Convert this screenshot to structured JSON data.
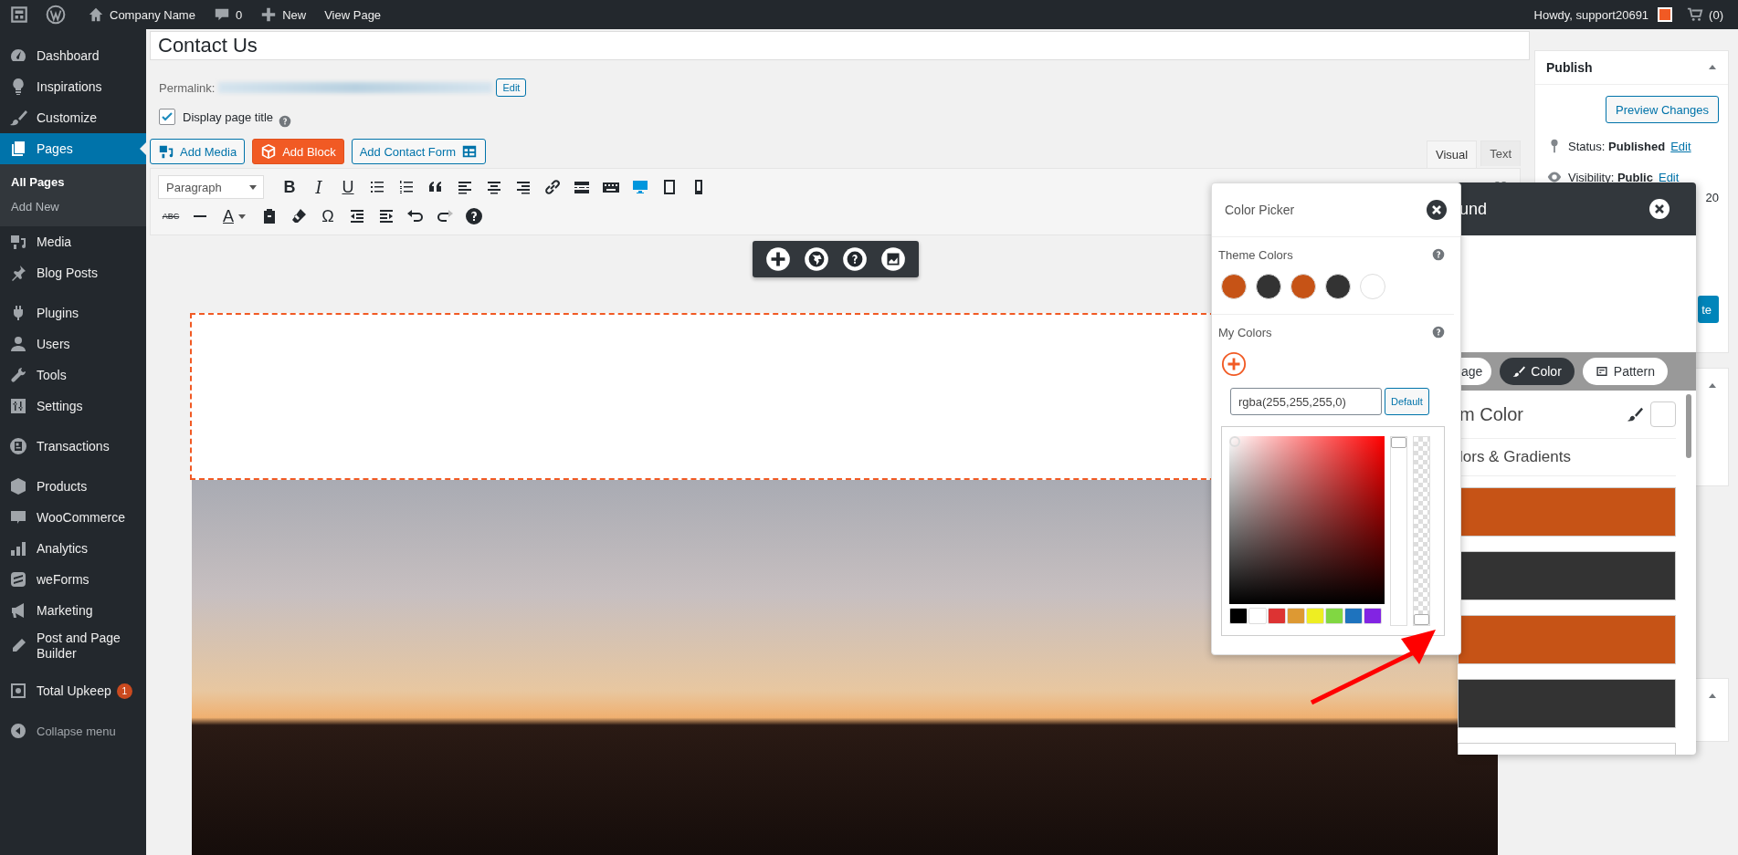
{
  "admin_bar": {
    "items": [
      {
        "kind": "home",
        "label": "Company Name"
      },
      {
        "kind": "comment",
        "label": "0"
      },
      {
        "kind": "plus",
        "label": "New"
      },
      {
        "kind": "none",
        "label": "View Page"
      }
    ],
    "greeting": "Howdy, support20691",
    "cart": "(0)"
  },
  "sidebar": {
    "groups": [
      [
        {
          "kind": "gauge",
          "label": "Dashboard",
          "selected": false
        },
        {
          "kind": "bulb",
          "label": "Inspirations",
          "selected": false
        },
        {
          "kind": "brush",
          "label": "Customize",
          "selected": false
        },
        {
          "kind": "pages",
          "label": "Pages",
          "selected": true,
          "submenu": [
            {
              "label": "All Pages",
              "selected": true
            },
            {
              "label": "Add New",
              "selected": false
            }
          ]
        },
        {
          "kind": "media",
          "label": "Media",
          "selected": false
        },
        {
          "kind": "pin",
          "label": "Blog Posts",
          "selected": false
        }
      ],
      [
        {
          "kind": "plug",
          "label": "Plugins",
          "selected": false
        },
        {
          "kind": "user",
          "label": "Users",
          "selected": false
        },
        {
          "kind": "wrench",
          "label": "Tools",
          "selected": false
        },
        {
          "kind": "sliders",
          "label": "Settings",
          "selected": false
        }
      ],
      [
        {
          "kind": "doc",
          "label": "Transactions",
          "selected": false
        }
      ],
      [
        {
          "kind": "box",
          "label": "Products",
          "selected": false
        },
        {
          "kind": "woo",
          "label": "WooCommerce",
          "selected": false
        },
        {
          "kind": "bars",
          "label": "Analytics",
          "selected": false
        },
        {
          "kind": "forms",
          "label": "weForms",
          "selected": false
        },
        {
          "kind": "megaphone",
          "label": "Marketing",
          "selected": false
        },
        {
          "kind": "pencil",
          "label": "Post and Page Builder",
          "selected": false
        }
      ],
      [
        {
          "kind": "safe",
          "label": "Total Upkeep",
          "selected": false,
          "badge": "1"
        }
      ]
    ],
    "collapse": "Collapse menu"
  },
  "editor": {
    "title": "Contact Us",
    "permalink_label": "Permalink:",
    "permalink_edit": "Edit",
    "display_title": {
      "label": "Display page title",
      "checked": true
    },
    "media_buttons": [
      {
        "kind": "media",
        "label": "Add Media"
      },
      {
        "kind": "block",
        "label": "Add Block"
      },
      {
        "kind": "form",
        "label": "Add Contact Form"
      }
    ],
    "tabs": [
      {
        "label": "Visual",
        "selected": true
      },
      {
        "label": "Text",
        "selected": false
      }
    ],
    "format": "Paragraph",
    "toolbar_rows": [
      [
        {
          "kind": "bold",
          "label": "B"
        },
        {
          "kind": "italic",
          "label": "I"
        },
        {
          "kind": "underline",
          "label": "U"
        },
        {
          "kind": "bullets"
        },
        {
          "kind": "numbers"
        },
        {
          "kind": "quote"
        },
        {
          "kind": "align-left"
        },
        {
          "kind": "align-center"
        },
        {
          "kind": "align-right"
        },
        {
          "kind": "link"
        },
        {
          "kind": "read-more"
        },
        {
          "kind": "keyboard"
        },
        {
          "kind": "desktop"
        },
        {
          "kind": "tablet"
        },
        {
          "kind": "mobile"
        }
      ],
      [
        {
          "kind": "strike",
          "label": "ABC"
        },
        {
          "kind": "hr"
        },
        {
          "kind": "text-color",
          "label": "A"
        },
        {
          "kind": "paste"
        },
        {
          "kind": "eraser"
        },
        {
          "kind": "char",
          "label": "Ω"
        },
        {
          "kind": "outdent"
        },
        {
          "kind": "indent"
        },
        {
          "kind": "undo"
        },
        {
          "kind": "redo"
        },
        {
          "kind": "help"
        }
      ]
    ],
    "float_tools": [
      {
        "kind": "plus"
      },
      {
        "kind": "globe"
      },
      {
        "kind": "help"
      },
      {
        "kind": "image"
      }
    ]
  },
  "publish": {
    "title": "Publish",
    "preview": "Preview Changes",
    "status": "Status: **Published**",
    "status_edit": "Edit",
    "visibility": "Visibility: **Public**",
    "visibility_edit": "Edit",
    "fragment": "20",
    "button_fragment": "te"
  },
  "color_picker": {
    "title": "Color Picker",
    "theme_label": "Theme Colors",
    "theme_colors": [
      {
        "color": "#c65316"
      },
      {
        "color": "#333333"
      },
      {
        "color": "#c65316"
      },
      {
        "color": "#333333"
      },
      {
        "color": "#ffffff"
      }
    ],
    "my_label": "My Colors",
    "value": "rgba(255,255,255,0)",
    "default": "Default",
    "palette": [
      {
        "color": "#000000"
      },
      {
        "color": "#ffffff"
      },
      {
        "color": "#dd3333"
      },
      {
        "color": "#dd9933"
      },
      {
        "color": "#eeee22"
      },
      {
        "color": "#81d742"
      },
      {
        "color": "#1e73be"
      },
      {
        "color": "#8224e3"
      }
    ],
    "hue": {
      "level": 1
    },
    "alpha": {
      "level": 0
    }
  },
  "background_panel": {
    "title": "und",
    "tabs": [
      {
        "label": "age",
        "selected": false
      },
      {
        "kind": "color",
        "label": "Color",
        "selected": true
      },
      {
        "kind": "pattern",
        "label": "Pattern",
        "selected": false
      }
    ],
    "custom_label": "m Color",
    "gradients_label": "lors & Gradients",
    "swatches": [
      {
        "color": "#c65316"
      },
      {
        "color": "#333333"
      },
      {
        "color": "#c65316"
      },
      {
        "color": "#333333"
      },
      {
        "color": "#ffffff"
      }
    ]
  }
}
